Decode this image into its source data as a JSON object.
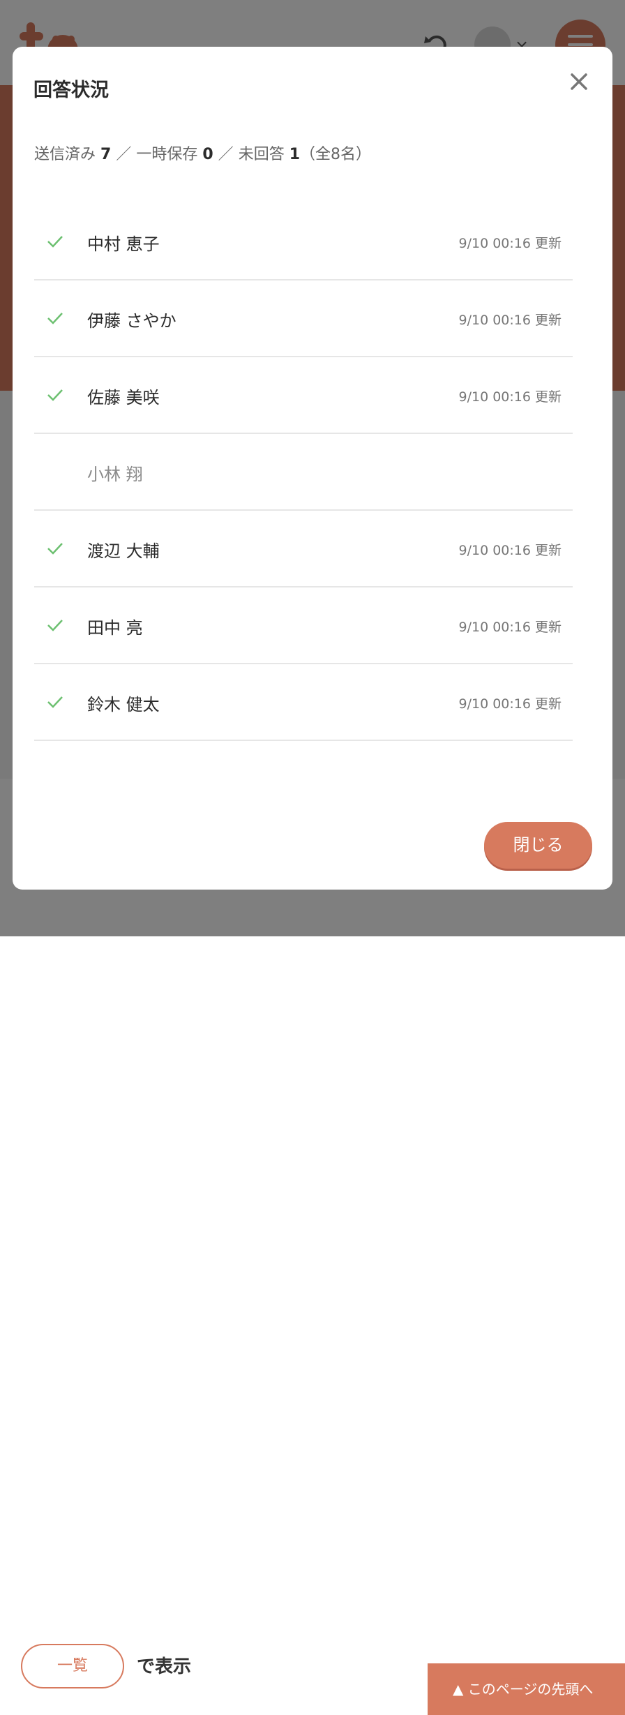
{
  "background": {
    "header_close": "×",
    "view_button_label": "一覧",
    "show_text": "で表示",
    "page_top_label": "▲ このページの先頭へ"
  },
  "modal": {
    "title": "回答状況",
    "summary": {
      "sent_label": "送信済み",
      "sent_count": "7",
      "sep1": "／",
      "draft_label": "一時保存",
      "draft_count": "0",
      "sep2": "／",
      "unanswered_label": "未回答",
      "unanswered_count": "1",
      "total": "（全8名）"
    },
    "respondents": [
      {
        "name": "中村 恵子",
        "status": "sent",
        "updated": "9/10 00:16 更新"
      },
      {
        "name": "伊藤 さやか",
        "status": "sent",
        "updated": "9/10 00:16 更新"
      },
      {
        "name": "佐藤 美咲",
        "status": "sent",
        "updated": "9/10 00:16 更新"
      },
      {
        "name": "小林 翔",
        "status": "unanswered",
        "updated": ""
      },
      {
        "name": "渡辺 大輔",
        "status": "sent",
        "updated": "9/10 00:16 更新"
      },
      {
        "name": "田中 亮",
        "status": "sent",
        "updated": "9/10 00:16 更新"
      },
      {
        "name": "鈴木 健太",
        "status": "sent",
        "updated": "9/10 00:16 更新"
      }
    ],
    "close_button_label": "閉じる"
  },
  "colors": {
    "accent": "#d77a5e",
    "check": "#6cc070",
    "overlay": "rgba(0,0,0,0.5)"
  },
  "icons": {
    "close": "close-icon",
    "check": "check-icon",
    "undo": "undo-icon",
    "menu": "hamburger-menu-icon"
  }
}
